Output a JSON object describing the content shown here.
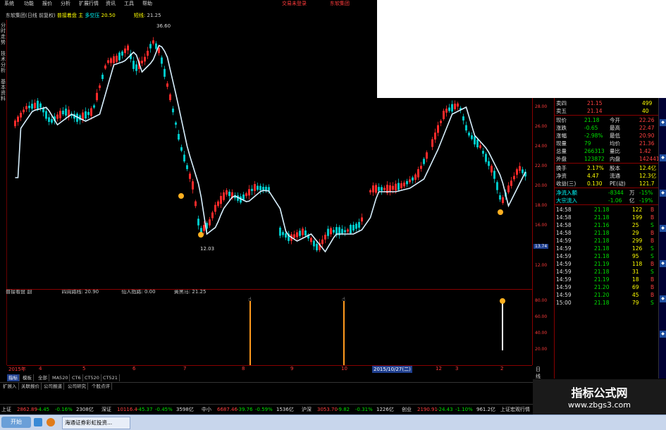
{
  "menu": [
    "系统",
    "功能",
    "报价",
    "分析",
    "扩展行情",
    "资讯",
    "工具",
    "帮助"
  ],
  "menu_right": [
    "交易未登录",
    "东软集团"
  ],
  "header": {
    "stock": "东软集团(日线 前复权)",
    "indicator": "普接着盘 主",
    "signal_label": "多空压",
    "signal_value": "20.50",
    "note_label": "短线:",
    "note_value": "21.25"
  },
  "left_tabs": [
    "分时走势",
    "技术分析",
    "基本资料"
  ],
  "price_axis": [
    "28.00",
    "26.00",
    "24.00",
    "22.00",
    "20.00",
    "18.00",
    "16.00",
    "14.00",
    "12.00"
  ],
  "current_price_tag": "13.74",
  "annotations": {
    "high": "36.60",
    "low": "12.03"
  },
  "sub_header": {
    "name": "普接看盘 副",
    "i1_label": "四周路线:",
    "i1_value": "20.90",
    "i2_label": "仙人指路:",
    "i2_value": "0.00",
    "i3_label": "黄黑马:",
    "i3_value": "21.25"
  },
  "sub_axis": [
    "80.00",
    "60.00",
    "40.00",
    "20.00"
  ],
  "date_axis": [
    "2015年",
    "4",
    "5",
    "6",
    "7",
    "8",
    "9",
    "10",
    "2015/10/27(二)",
    "12",
    "3",
    "2"
  ],
  "date_axis_right": "日线",
  "quote": {
    "order_book": [
      {
        "label": "卖四",
        "price": "21.15",
        "vol": "499"
      },
      {
        "label": "卖五",
        "price": "21.14",
        "vol": "40"
      }
    ],
    "stats": [
      {
        "l1": "现价",
        "v1": "21.18",
        "l2": "今开",
        "v2": "22.26"
      },
      {
        "l1": "涨跌",
        "v1": "-0.65",
        "l2": "最高",
        "v2": "22.47"
      },
      {
        "l1": "涨幅",
        "v1": "-2.98%",
        "l2": "最低",
        "v2": "20.90"
      },
      {
        "l1": "现量",
        "v1": "79",
        "l2": "均价",
        "v2": "21.36"
      },
      {
        "l1": "总量",
        "v1": "266313",
        "l2": "量比",
        "v2": "1.42"
      },
      {
        "l1": "外盘",
        "v1": "123872",
        "l2": "内盘",
        "v2": "142441"
      }
    ],
    "stats2": [
      {
        "l1": "换手",
        "v1": "2.17%",
        "l2": "股本",
        "v2": "12.4亿"
      },
      {
        "l1": "净资",
        "v1": "4.47",
        "l2": "流通",
        "v2": "12.3亿"
      },
      {
        "l1": "收益(三)",
        "v1": "0.130",
        "l2": "PE(动)",
        "v2": "121.7"
      }
    ],
    "flows": [
      {
        "label": "净流入额",
        "value": "-8344",
        "unit": "万",
        "pct": "-15%"
      },
      {
        "label": "大宗流入",
        "value": "-1.06",
        "unit": "亿",
        "pct": "-19%"
      }
    ],
    "ticks": [
      {
        "t": "14:58",
        "p": "21.18",
        "v": "122",
        "s": "B"
      },
      {
        "t": "14:58",
        "p": "21.18",
        "v": "199",
        "s": "B"
      },
      {
        "t": "14:58",
        "p": "21.16",
        "v": "25",
        "s": "S"
      },
      {
        "t": "14:58",
        "p": "21.18",
        "v": "29",
        "s": "B"
      },
      {
        "t": "14:59",
        "p": "21.18",
        "v": "299",
        "s": "B"
      },
      {
        "t": "14:59",
        "p": "21.18",
        "v": "126",
        "s": "S"
      },
      {
        "t": "14:59",
        "p": "21.18",
        "v": "95",
        "s": "S"
      },
      {
        "t": "14:59",
        "p": "21.19",
        "v": "118",
        "s": "B"
      },
      {
        "t": "14:59",
        "p": "21.18",
        "v": "31",
        "s": "S"
      },
      {
        "t": "14:59",
        "p": "21.19",
        "v": "18",
        "s": "B"
      },
      {
        "t": "14:59",
        "p": "21.20",
        "v": "69",
        "s": "B"
      },
      {
        "t": "14:59",
        "p": "21.20",
        "v": "45",
        "s": "B"
      },
      {
        "t": "15:00",
        "p": "21.18",
        "v": "79",
        "s": "S"
      }
    ]
  },
  "bottom_tabs": [
    "指标",
    "模板",
    "全部",
    "MA520",
    "CT6",
    "CT520",
    "CT521"
  ],
  "bottom_tabs2": [
    "扩展入",
    "关联报价",
    "公司报道",
    "公司研究",
    "个股点评"
  ],
  "ticker": [
    {
      "name": "上证",
      "val": "2862.89",
      "chg": "-4.45",
      "pct": "-0.16%",
      "amt": "2308亿"
    },
    {
      "name": "深证",
      "val": "10116.4",
      "chg": "-45.37",
      "pct": "-0.45%",
      "amt": "3598亿"
    },
    {
      "name": "中小",
      "val": "6687.46",
      "chg": "-39.76",
      "pct": "-0.59%",
      "amt": "1536亿"
    },
    {
      "name": "沪深",
      "val": "3053.70",
      "chg": "-9.82",
      "pct": "-0.31%",
      "amt": "1226亿"
    },
    {
      "name": "创业",
      "val": "2190.91",
      "chg": "-24.43",
      "pct": "-1.10%",
      "amt": "961.2亿"
    }
  ],
  "ticker_right": "上证宏观行情",
  "taskbar": {
    "start": "开始",
    "item": "海通证券彩虹投资..."
  },
  "watermark": {
    "line1": "指标公式网",
    "line2": "www.zbgs3.com"
  },
  "colors": {
    "up": "#ff2a2a",
    "down": "#00c8c8",
    "ma": "#d8f0ff",
    "bar": "#ff9a1e",
    "grid": "#7a0000"
  }
}
